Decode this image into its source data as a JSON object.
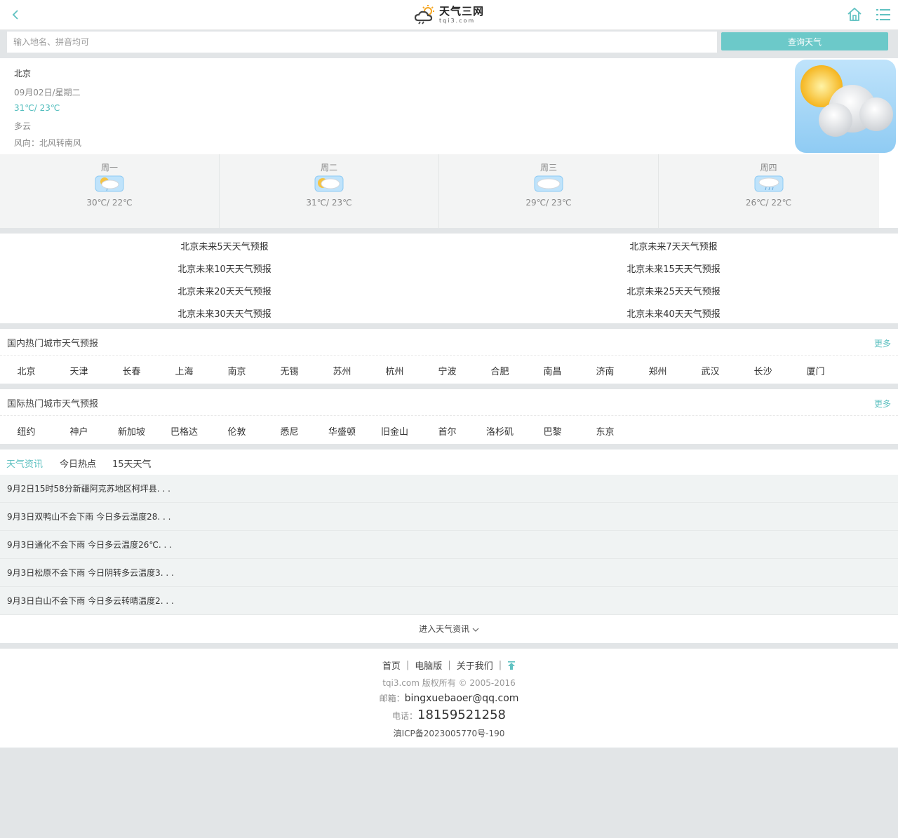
{
  "header": {
    "logo_title": "天气三网",
    "logo_sub": "tqi3.com"
  },
  "search": {
    "placeholder": "输入地名、拼音均可",
    "button": "查询天气"
  },
  "current": {
    "city": "北京",
    "date": "09月02日/星期二",
    "temp": "31℃/ 23℃",
    "condition": "多云",
    "wind": "风向：北风转南风"
  },
  "days": [
    {
      "name": "周一",
      "temp": "30℃/ 22℃",
      "icon": "partly-cloudy-rain-icon"
    },
    {
      "name": "周二",
      "temp": "31℃/ 23℃",
      "icon": "partly-cloudy-icon"
    },
    {
      "name": "周三",
      "temp": "29℃/ 23℃",
      "icon": "cloudy-icon"
    },
    {
      "name": "周四",
      "temp": "26℃/ 22℃",
      "icon": "rain-icon"
    }
  ],
  "links": [
    "北京未来5天天气预报",
    "北京未来7天天气预报",
    "北京未来10天天气预报",
    "北京未来15天天气预报",
    "北京未来20天天气预报",
    "北京未来25天天气预报",
    "北京未来30天天气预报",
    "北京未来40天天气预报"
  ],
  "domestic": {
    "title": "国内热门城市天气预报",
    "more": "更多",
    "cities": [
      "北京",
      "天津",
      "长春",
      "上海",
      "南京",
      "无锡",
      "苏州",
      "杭州",
      "宁波",
      "合肥",
      "南昌",
      "济南",
      "郑州",
      "武汉",
      "长沙",
      "厦门"
    ]
  },
  "international": {
    "title": "国际热门城市天气预报",
    "more": "更多",
    "cities": [
      "纽约",
      "神户",
      "新加坡",
      "巴格达",
      "伦敦",
      "悉尼",
      "华盛顿",
      "旧金山",
      "首尔",
      "洛杉矶",
      "巴黎",
      "东京"
    ]
  },
  "news": {
    "tabs": [
      "天气资讯",
      "今日热点",
      "15天天气"
    ],
    "items": [
      "9月2日15时58分新疆阿克苏地区柯坪县. . .",
      "9月3日双鸭山不会下雨 今日多云温度28. . .",
      "9月3日通化不会下雨 今日多云温度26℃. . .",
      "9月3日松原不会下雨 今日阴转多云温度3. . .",
      "9月3日白山不会下雨 今日多云转晴温度2. . ."
    ],
    "more": "进入天气资讯"
  },
  "footer": {
    "nav": [
      "首页",
      "电脑版",
      "关于我们"
    ],
    "copyright": "tqi3.com 版权所有 © 2005-2016",
    "mail_label": "邮箱：",
    "mail": "bingxuebaoer@qq.com",
    "tel_label": "电话：",
    "tel": "18159521258",
    "icp": "滇ICP备2023005770号-190"
  },
  "colors": {
    "accent": "#6cc9c9",
    "link_accent": "#5fc1c1"
  }
}
